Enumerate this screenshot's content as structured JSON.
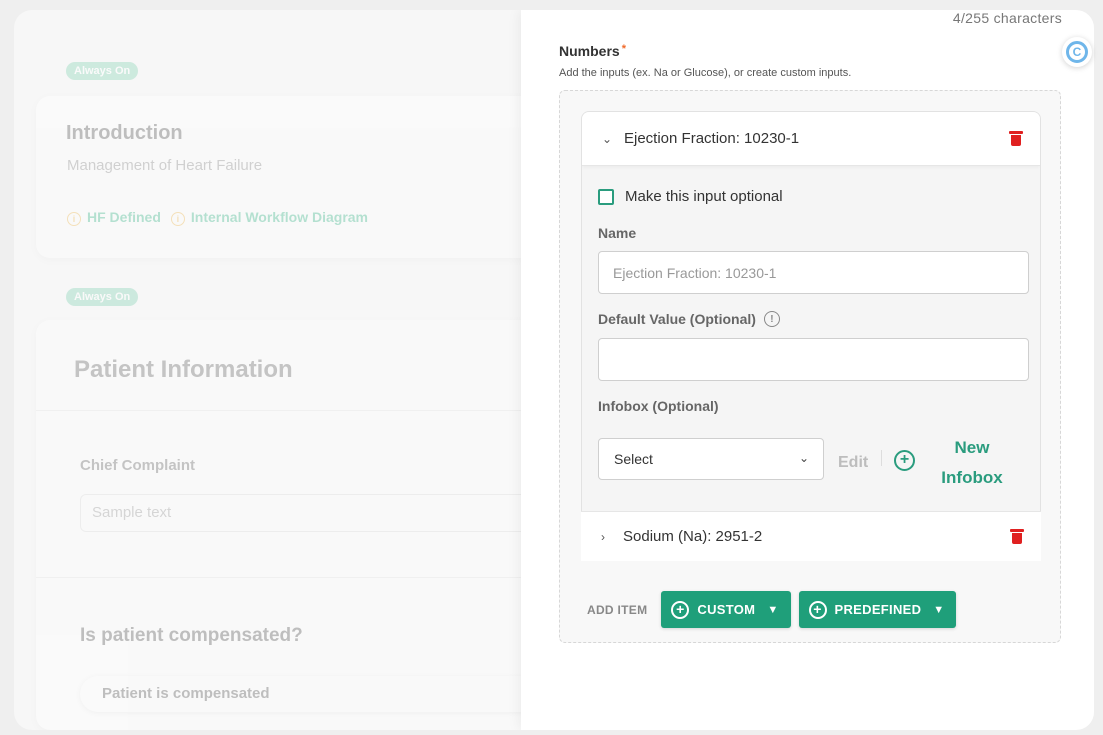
{
  "background": {
    "intro_badge": "Always On",
    "intro_title": "Introduction",
    "intro_subtitle": "Management of Heart Failure",
    "intro_links": [
      "HF Defined",
      "Internal Workflow Diagram"
    ],
    "patient_badge": "Always On",
    "patient_title": "Patient Information",
    "chief_label": "Chief Complaint",
    "chief_placeholder": "Sample text",
    "compensated_label": "Is patient compensated?",
    "compensated_option": "Patient is compensated"
  },
  "panel": {
    "char_count": "4/255 characters",
    "section_title": "Numbers",
    "required_mark": "*",
    "section_help": "Add the inputs (ex. Na or Glucose), or create custom inputs.",
    "items": [
      {
        "label": "Ejection Fraction: 10230-1",
        "expanded": true,
        "optional_label": "Make this input optional",
        "name_label": "Name",
        "name_placeholder": "Ejection Fraction: 10230-1",
        "default_label": "Default Value (Optional)",
        "default_value": "",
        "infobox_label": "Infobox (Optional)",
        "infobox_select": "Select",
        "edit_label": "Edit",
        "new_infobox_label": "New Infobox"
      },
      {
        "label": "Sodium (Na): 2951-2",
        "expanded": false
      }
    ],
    "add_item_label": "ADD ITEM",
    "custom_button": "CUSTOM",
    "predefined_button": "PREDEFINED"
  },
  "colors": {
    "accent": "#1f9f7a",
    "delete": "#e02020",
    "badge": "#7fd0b0"
  }
}
